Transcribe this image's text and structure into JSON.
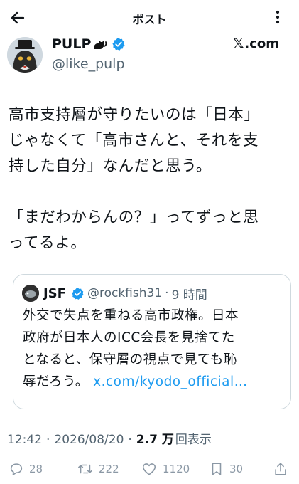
{
  "header": {
    "title": "ポスト",
    "back_icon": "arrow-left-icon",
    "more_icon": "more-vertical-icon"
  },
  "author": {
    "display_name": "PULP",
    "handle": "@like_pulp",
    "verified": true,
    "source_label": ".com",
    "source_mark": "𝕏"
  },
  "post": {
    "lines_paragraph_1": [
      "高市支持層が守りたいのは「日本」",
      "じゃなくて「高市さんと、それを支",
      "持した自分」なんだと思う。"
    ],
    "lines_paragraph_2": [
      "「まだわからんの？」ってずっと思",
      "ってるよ。"
    ]
  },
  "quote": {
    "name": "JSF",
    "handle": "@rockfish31",
    "separator": "·",
    "time": "9 時間",
    "lines": [
      "外交で失点を重ねる高市政権。日本",
      "政府が日本人のICC会長を見捨てた",
      "となると、保守層の視点で見ても恥"
    ],
    "last_line_text": "辱だろう。",
    "link": "x.com/kyodo_official…"
  },
  "meta": {
    "time": "12:42",
    "sep1": "·",
    "date": "2026/08/20",
    "sep2": "·",
    "views_count": "2.7 万",
    "views_label": "回表示"
  },
  "actions": {
    "replies": "28",
    "reposts": "222",
    "likes": "1120",
    "bookmarks": "30"
  },
  "colors": {
    "text": "#0f1419",
    "secondary": "#536471",
    "accent": "#1d9bf0",
    "border": "#cfd9de",
    "action_gray": "#8b98a5"
  }
}
